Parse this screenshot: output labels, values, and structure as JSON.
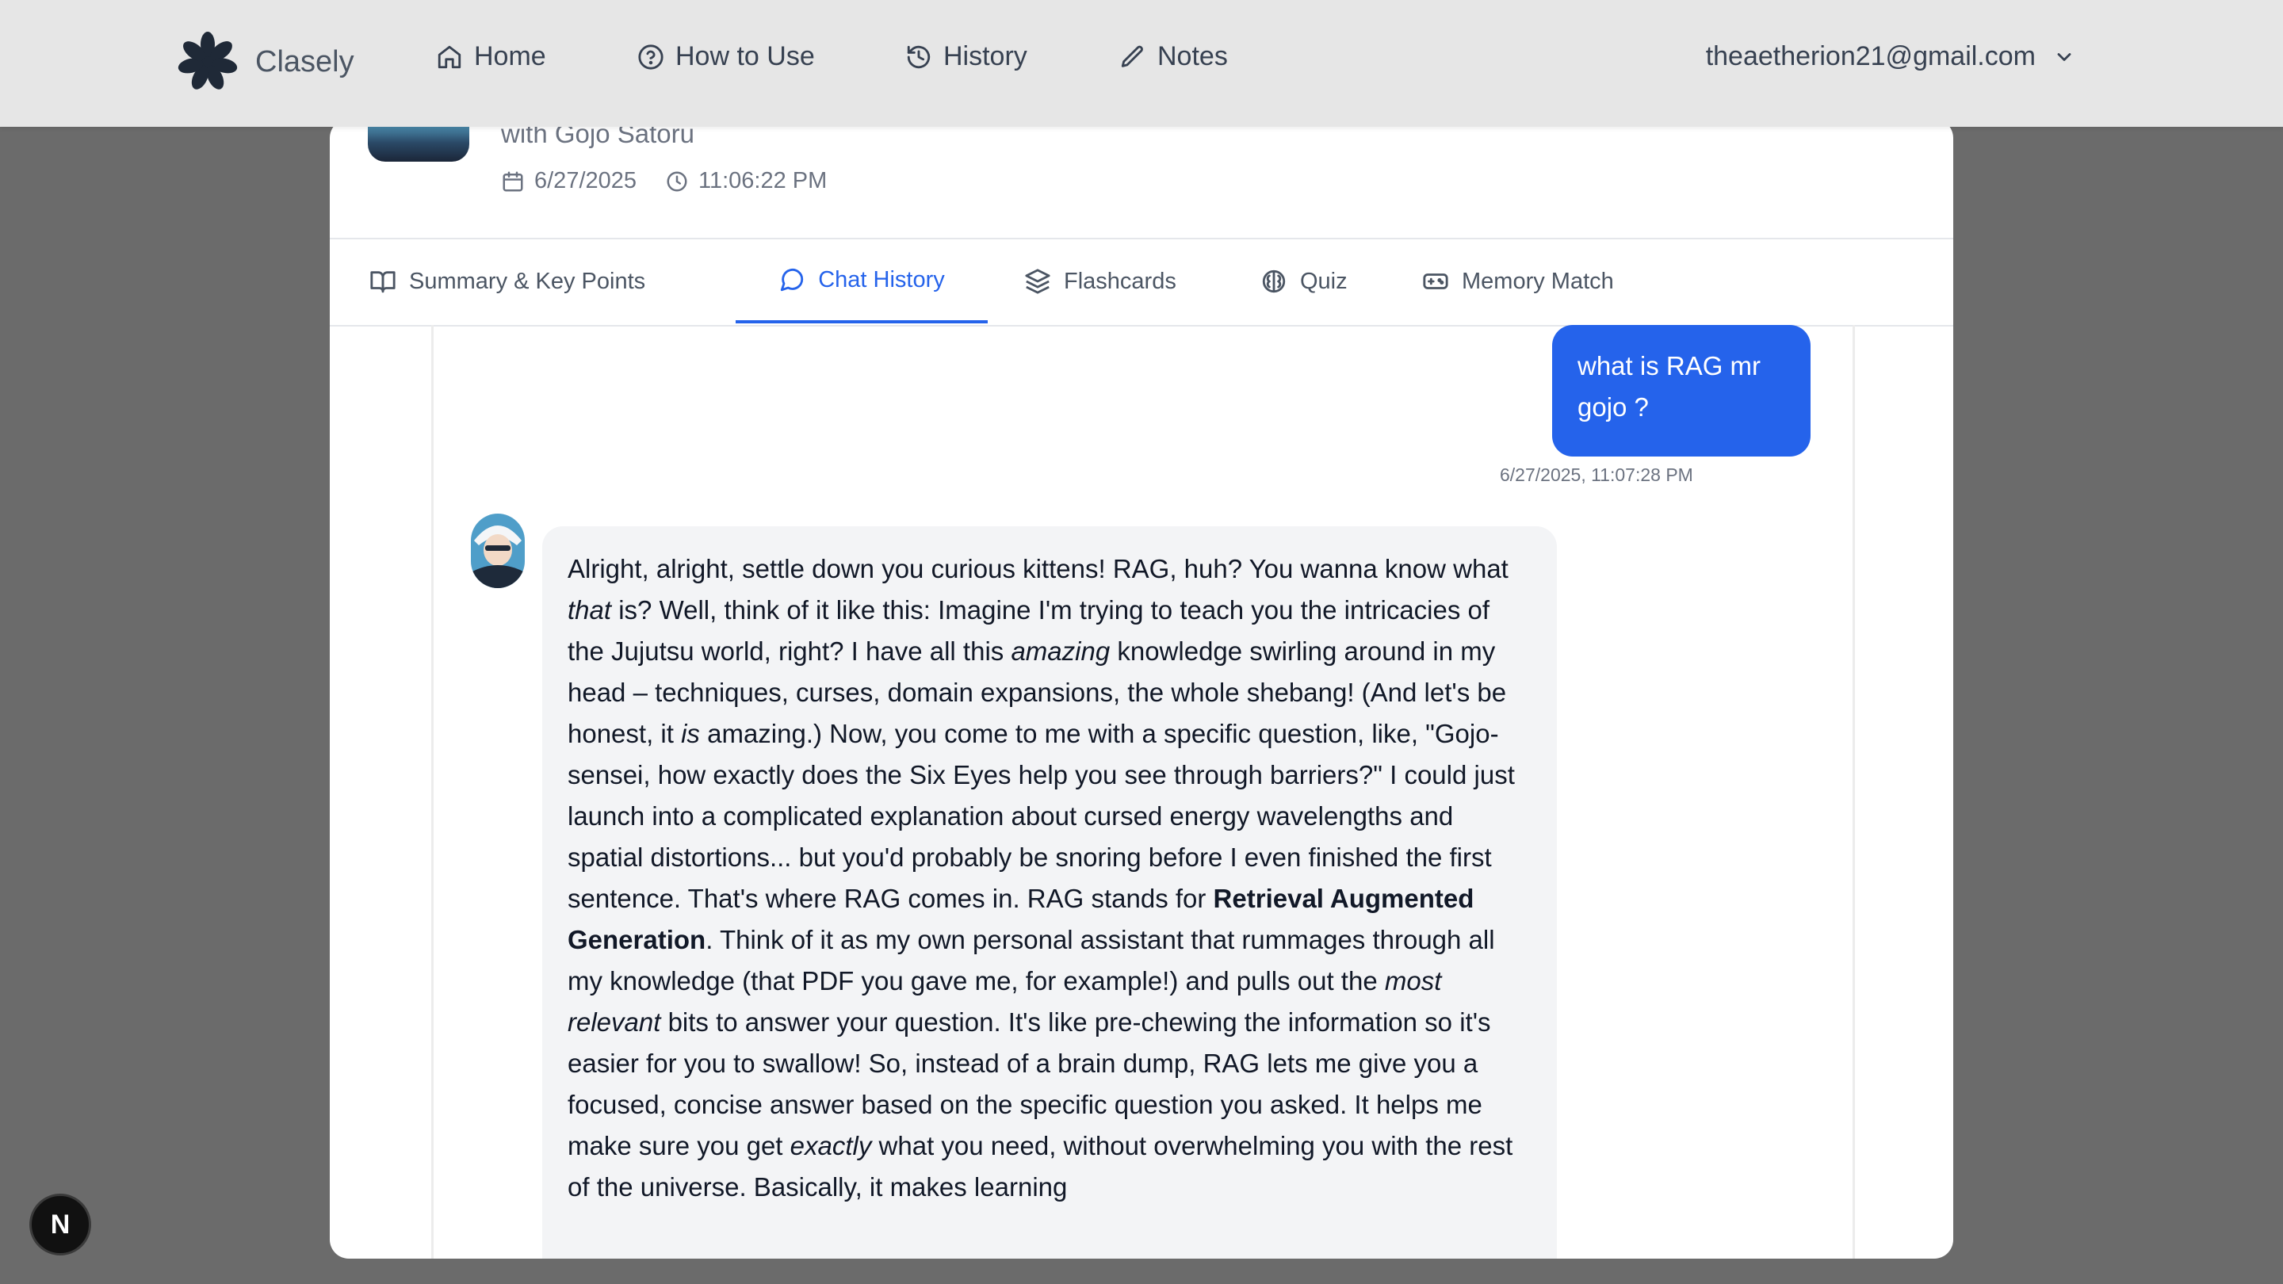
{
  "app": {
    "brand": "Clasely"
  },
  "nav": {
    "items": [
      {
        "label": "Home",
        "icon": "home-icon"
      },
      {
        "label": "How to Use",
        "icon": "help-circle-icon"
      },
      {
        "label": "History",
        "icon": "history-icon"
      },
      {
        "label": "Notes",
        "icon": "pen-icon"
      }
    ],
    "user_email": "theaetherion21@gmail.com"
  },
  "session": {
    "subtitle": "with Gojo Satoru",
    "date": "6/27/2025",
    "time": "11:06:22 PM"
  },
  "tabs": [
    {
      "label": "Summary & Key Points",
      "icon": "book-icon",
      "active": false
    },
    {
      "label": "Chat History",
      "icon": "chat-bubble-icon",
      "active": true
    },
    {
      "label": "Flashcards",
      "icon": "layers-icon",
      "active": false
    },
    {
      "label": "Quiz",
      "icon": "brain-icon",
      "active": false
    },
    {
      "label": "Memory Match",
      "icon": "gamepad-icon",
      "active": false
    }
  ],
  "chat": {
    "user_message": "what is RAG mr gojo ?",
    "user_timestamp": "6/27/2025, 11:07:28 PM",
    "bot_segments": [
      {
        "t": "Alright, alright, settle down you curious kittens! RAG, huh? You wanna know what "
      },
      {
        "t": "that",
        "s": "i"
      },
      {
        "t": " is? Well, think of it like this: Imagine I'm trying to teach you the intricacies of the Jujutsu world, right? I have all this "
      },
      {
        "t": "amazing",
        "s": "i"
      },
      {
        "t": " knowledge swirling around in my head – techniques, curses, domain expansions, the whole shebang! (And let's be honest, it "
      },
      {
        "t": "is",
        "s": "i"
      },
      {
        "t": " amazing.) Now, you come to me with a specific question, like, \"Gojo-sensei, how exactly does the Six Eyes help you see through barriers?\" I could just launch into a complicated explanation about cursed energy wavelengths and spatial distortions... but you'd probably be snoring before I even finished the first sentence. That's where RAG comes in. RAG stands for "
      },
      {
        "t": "Retrieval Augmented Generation",
        "s": "b"
      },
      {
        "t": ". Think of it as my own personal assistant that rummages through all my knowledge (that PDF you gave me, for example!) and pulls out the "
      },
      {
        "t": "most relevant",
        "s": "i"
      },
      {
        "t": " bits to answer your question. It's like pre-chewing the information so it's easier for you to swallow! So, instead of a brain dump, RAG lets me give you a focused, concise answer based on the specific question you asked. It helps me make sure you get "
      },
      {
        "t": "exactly",
        "s": "i"
      },
      {
        "t": " what you need, without overwhelming you with the rest of the universe. Basically, it makes learning"
      }
    ]
  },
  "badge": {
    "letter": "N"
  },
  "colors": {
    "accent": "#2563eb",
    "backdrop": "#6b6b6b"
  }
}
